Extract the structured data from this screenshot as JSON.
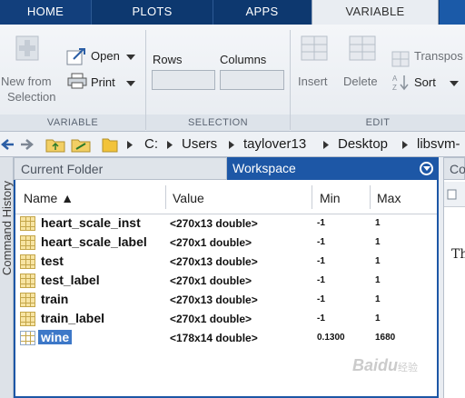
{
  "tabs": {
    "home": "HOME",
    "plots": "PLOTS",
    "apps": "APPS",
    "variable": "VARIABLE"
  },
  "ribbon": {
    "new_from_selection": [
      "New from",
      "Selection"
    ],
    "open": "Open",
    "print": "Print",
    "rows": "Rows",
    "columns": "Columns",
    "insert": "Insert",
    "delete": "Delete",
    "transpose": "Transpos",
    "sort": "Sort",
    "sections": {
      "variable": "VARIABLE",
      "selection": "SELECTION",
      "edit": "EDIT"
    }
  },
  "address": {
    "drive": "C:",
    "path": [
      "Users",
      "taylover13",
      "Desktop",
      "libsvm-"
    ]
  },
  "side": {
    "command_history": "Command History"
  },
  "panels": {
    "current_folder": "Current Folder",
    "workspace": "Workspace",
    "right_tab": "Co"
  },
  "workspace": {
    "columns": {
      "name": "Name ▲",
      "value": "Value",
      "min": "Min",
      "max": "Max"
    },
    "rows": [
      {
        "name": "heart_scale_inst",
        "value": "<270x13 double>",
        "min": "-1",
        "max": "1"
      },
      {
        "name": "heart_scale_label",
        "value": "<270x1 double>",
        "min": "-1",
        "max": "1"
      },
      {
        "name": "test",
        "value": "<270x13 double>",
        "min": "-1",
        "max": "1"
      },
      {
        "name": "test_label",
        "value": "<270x1 double>",
        "min": "-1",
        "max": "1"
      },
      {
        "name": "train",
        "value": "<270x13 double>",
        "min": "-1",
        "max": "1"
      },
      {
        "name": "train_label",
        "value": "<270x1 double>",
        "min": "-1",
        "max": "1"
      },
      {
        "name": "wine",
        "value": "<178x14 double>",
        "min": "0.1300",
        "max": "1680",
        "selected": true
      }
    ]
  },
  "right_panel": {
    "text": "Th"
  },
  "watermark": {
    "brand": "Bai",
    "brand2": "du",
    "sub": "经验"
  }
}
